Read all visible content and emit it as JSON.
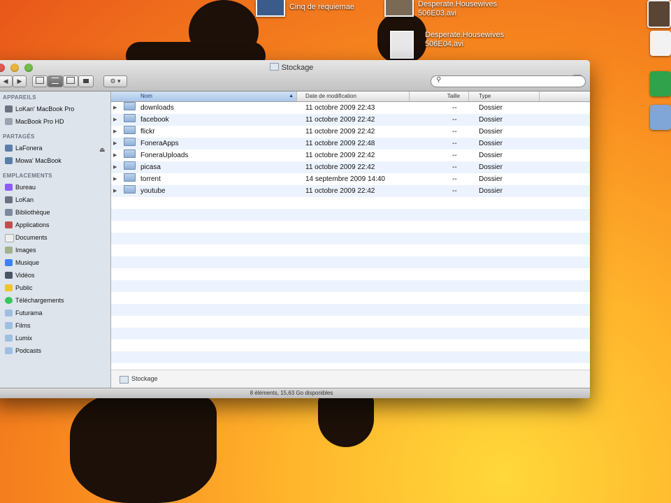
{
  "desktop": {
    "items": [
      {
        "label": "Cinq de requiemae",
        "color": "#3b5b8a"
      },
      {
        "label": "Desperate.Housewives\n506E03.avi",
        "color": "#7a6a55"
      },
      {
        "label": "Desperate.Housewives\n506E04.avi",
        "color": "#e8e8e8"
      }
    ]
  },
  "window": {
    "title": "Stockage",
    "search_placeholder": "",
    "toolbar": {
      "back": "◀",
      "forward": "▶",
      "action": "⚙ ▾"
    },
    "sidebar": {
      "sections": [
        {
          "header": "APPAREILS",
          "items": [
            {
              "label": "LoKan' MacBook Pro",
              "icon": "laptop-icon",
              "color": "#6b7280"
            },
            {
              "label": "MacBook Pro HD",
              "icon": "harddisk-icon",
              "color": "#9ca3af"
            }
          ]
        },
        {
          "header": "PARTAGÉS",
          "items": [
            {
              "label": "LaFonera",
              "icon": "network-computer-icon",
              "color": "#5b7ea8",
              "eject": "⏏"
            },
            {
              "label": "Mowa' MacBook",
              "icon": "network-computer-icon",
              "color": "#5b7ea8"
            }
          ]
        },
        {
          "header": "EMPLACEMENTS",
          "items": [
            {
              "label": "Bureau",
              "icon": "desktop-icon",
              "color": "#8b5cf6"
            },
            {
              "label": "LoKan",
              "icon": "home-icon",
              "color": "#6b7280"
            },
            {
              "label": "Bibliothèque",
              "icon": "library-icon",
              "color": "#7c8a9e"
            },
            {
              "label": "Applications",
              "icon": "applications-icon",
              "color": "#c0504d"
            },
            {
              "label": "Documents",
              "icon": "documents-icon",
              "color": "#eeeeee"
            },
            {
              "label": "Images",
              "icon": "images-icon",
              "color": "#a3b18a"
            },
            {
              "label": "Musique",
              "icon": "music-icon",
              "color": "#3b82f6"
            },
            {
              "label": "Vidéos",
              "icon": "videos-icon",
              "color": "#4b5563"
            },
            {
              "label": "Public",
              "icon": "public-icon",
              "color": "#f2c230"
            },
            {
              "label": "Téléchargements",
              "icon": "downloads-icon",
              "color": "#34c759"
            },
            {
              "label": "Futurama",
              "icon": "folder-icon",
              "color": "#9fbfe0"
            },
            {
              "label": "Films",
              "icon": "folder-icon",
              "color": "#9fbfe0"
            },
            {
              "label": "Lumix",
              "icon": "folder-icon",
              "color": "#9fbfe0"
            },
            {
              "label": "Podcasts",
              "icon": "folder-icon",
              "color": "#9fbfe0"
            }
          ]
        }
      ]
    },
    "columns": {
      "name": "Nom",
      "modified": "Date de modification",
      "size": "Taille",
      "kind": "Type"
    },
    "files": [
      {
        "name": "downloads",
        "modified": "11 octobre 2009 22:43",
        "size": "--",
        "kind": "Dossier"
      },
      {
        "name": "facebook",
        "modified": "11 octobre 2009 22:42",
        "size": "--",
        "kind": "Dossier"
      },
      {
        "name": "flickr",
        "modified": "11 octobre 2009 22:42",
        "size": "--",
        "kind": "Dossier"
      },
      {
        "name": "FoneraApps",
        "modified": "11 octobre 2009 22:48",
        "size": "--",
        "kind": "Dossier"
      },
      {
        "name": "FoneraUploads",
        "modified": "11 octobre 2009 22:42",
        "size": "--",
        "kind": "Dossier"
      },
      {
        "name": "picasa",
        "modified": "11 octobre 2009 22:42",
        "size": "--",
        "kind": "Dossier"
      },
      {
        "name": "torrent",
        "modified": "14 septembre 2009 14:40",
        "size": "--",
        "kind": "Dossier"
      },
      {
        "name": "youtube",
        "modified": "11 octobre 2009 22:42",
        "size": "--",
        "kind": "Dossier"
      }
    ],
    "path": "Stockage",
    "status": "8 éléments, 15,63 Go disponibles"
  }
}
